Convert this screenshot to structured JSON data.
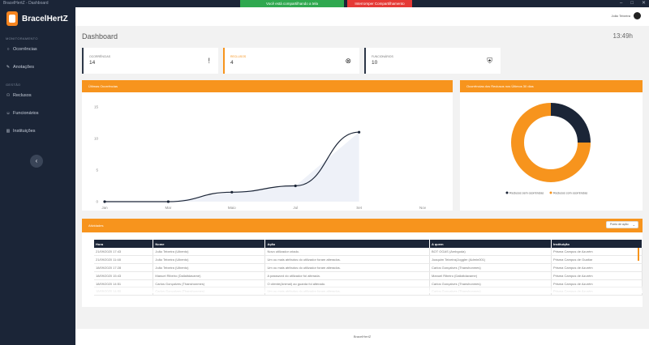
{
  "window": {
    "title": "BracelHertZ - Dashboard",
    "share_message": "Você está compartilhando a tela",
    "stop_sharing": "Interromper Compartilhamento"
  },
  "brand": {
    "name": "BracelHertZ"
  },
  "sidebar": {
    "section_monitoring": "MONITORAMENTO",
    "section_management": "GESTÃO",
    "items": [
      {
        "label": "Ocorrências",
        "icon": "circle-icon"
      },
      {
        "label": "Anotações",
        "icon": "pin-icon"
      },
      {
        "label": "Reclusos",
        "icon": "users-icon"
      },
      {
        "label": "Funcionários",
        "icon": "employee-icon"
      },
      {
        "label": "Instituições",
        "icon": "building-icon"
      }
    ],
    "collapse_glyph": "‹"
  },
  "header": {
    "user_name": "João Teixeira"
  },
  "page": {
    "title": "Dashboard",
    "clock": "13:49h"
  },
  "stats": [
    {
      "label": "OCORRÊNCIAS",
      "value": "14",
      "icon": "alert-icon",
      "glyph": "!"
    },
    {
      "label": "RECLUSOS",
      "value": "4",
      "icon": "handcuffs-icon",
      "glyph": "⊗"
    },
    {
      "label": "FUNCIONÁRIOS",
      "value": "10",
      "icon": "badge-icon",
      "glyph": "⛨"
    }
  ],
  "occurrences_panel": {
    "title": "Últimas Ocorrências"
  },
  "chart_data": {
    "type": "area",
    "categories": [
      "Jan",
      "Mar",
      "Maio",
      "Jul",
      "Set",
      "Nov"
    ],
    "points": [
      {
        "x": 0,
        "y": 0
      },
      {
        "x": 1,
        "y": 0
      },
      {
        "x": 2,
        "y": 1.5
      },
      {
        "x": 3,
        "y": 2.5
      },
      {
        "x": 4,
        "y": 11
      }
    ],
    "yticks": [
      "0",
      "5",
      "10",
      "15"
    ],
    "ylim": [
      0,
      15
    ],
    "grid": false
  },
  "donut_panel": {
    "title": "Ocorrências dos Reclusos nos Últimos 30 dias",
    "slices": [
      {
        "label": "Reclusos sem ocorrências",
        "value": 25,
        "color": "#1b2537"
      },
      {
        "label": "Reclusos com ocorrências",
        "value": 75,
        "color": "#f7941d"
      }
    ]
  },
  "activity_panel": {
    "title": "Atividades",
    "filter_value": "Ponto de ação",
    "columns": [
      "Hora",
      "Nome",
      "Ação",
      "A quem",
      "Instituição"
    ],
    "rows": [
      [
        "21/09/2020 17:43",
        "João Teixeira (Ulbento)",
        "Novo utilizador criado.",
        "BOT OGAS (Ambgoda)",
        "Prisma Campus de Azurém"
      ],
      [
        "21/09/2020 11:48",
        "João Teixeira (Ulbento)",
        "Um ou mais atributos do utilizador foram alterados.",
        "Joaquim Teixeira(Joggler (Admin001)",
        "Prisma Campus de Gualtar"
      ],
      [
        "18/09/2020 17:28",
        "João Teixeira (Ulbento)",
        "Um ou mais atributos do utilizador foram alterados.",
        "Carlos Gonçalves (Thanshonmes)",
        "Prisma Campus de Azurém"
      ],
      [
        "18/09/2020 15:43",
        "Manuel Ribeiro (Dallaltdavame)",
        "A password do utilizador foi alterada.",
        "Manuel Ribeiro (Dallaltdavame)",
        "Prisma Campus de Azurém"
      ],
      [
        "18/09/2020 14:51",
        "Carlos Gonçalves (Thanshonmes)",
        "O cliente(Animal) ao guarda foi alterado.",
        "Carlos Gonçalves (Thanshonmes)",
        "Prisma Campus de Azurém"
      ],
      [
        "18/09/2020 14:50",
        "Carlos Gonçalves (Thanshonmes)",
        "Um ou mais atributos do utilizador foram alterados.",
        "Carlos Gonçalves (Thanshonmes)",
        "Prisma Campus de Azurém"
      ]
    ]
  },
  "footer": {
    "text": "BracelHertZ"
  }
}
